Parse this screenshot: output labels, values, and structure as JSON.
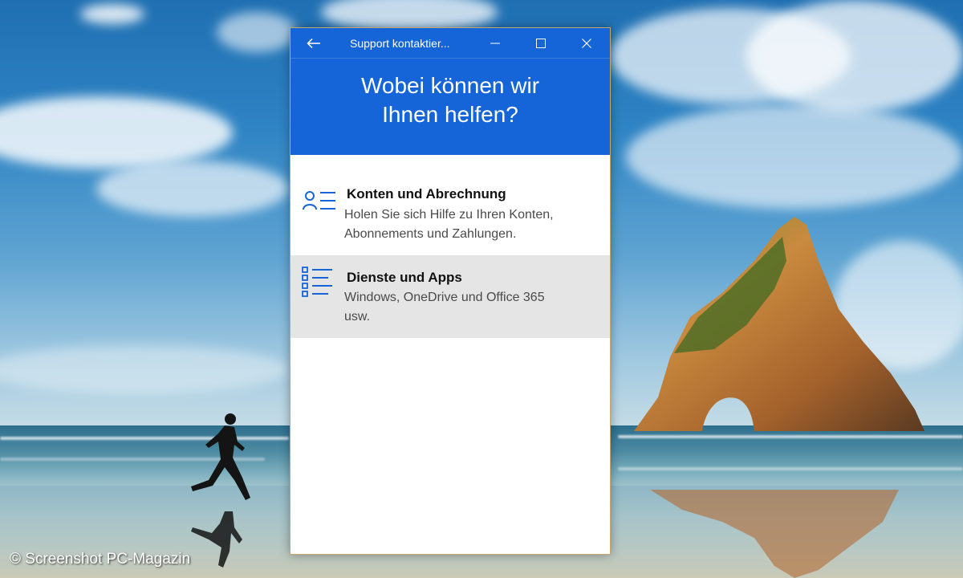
{
  "window": {
    "title": "Support kontaktier...",
    "back_icon": "back-arrow-icon",
    "minimize_icon": "minimize-icon",
    "maximize_icon": "maximize-icon",
    "close_icon": "close-icon",
    "accent_color": "#1565d8"
  },
  "header": {
    "line1": "Wobei können wir",
    "line2": "Ihnen helfen?"
  },
  "items": [
    {
      "icon": "person-list-icon",
      "title": "Konten und Abrechnung",
      "desc_line1": "Holen Sie sich Hilfe zu Ihren Konten,",
      "desc_line2": "Abonnements und Zahlungen.",
      "highlighted": false
    },
    {
      "icon": "checklist-icon",
      "title": "Dienste und Apps",
      "desc_line1": "Windows, OneDrive und Office 365",
      "desc_line2": "usw.",
      "highlighted": true
    }
  ],
  "watermark": "© Screenshot PC-Magazin"
}
